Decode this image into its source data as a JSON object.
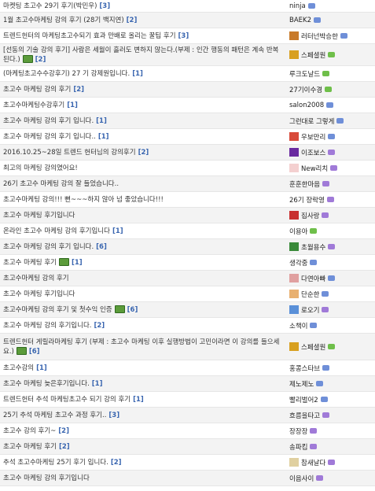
{
  "rows": [
    {
      "title": "마켓팅 초고수 29기 후기(박민우)",
      "count": "[3]",
      "author": "ninja",
      "avatar": "",
      "level": "#6f8fd8"
    },
    {
      "title": "1월 초고수마케팅 강의 후기 (28기 백지연)",
      "count": "[2]",
      "author": "BAEK2",
      "avatar": "",
      "level": "#6f8fd8"
    },
    {
      "title": "트렌드헌터의 마케팅초고수되기 효과 만배로 올리는 꿀팁 후기",
      "count": "[3]",
      "author": "러터넌박승한",
      "avatar": "#c87a2a",
      "level": "#6f8fd8"
    },
    {
      "title": "[선동의 기술 강의 후기] 사람은 세월이 흘러도 변하지 않는다.(부제 : 인간 행동의 패턴은 계속 반복된다.)",
      "count": "[2]",
      "author": "스페셜원",
      "avatar": "#d8a020",
      "level": "#6fbf4a",
      "img": true
    },
    {
      "title": "(마케팅초고수수강후기) 27 기 강제원입니다.",
      "count": "[1]",
      "author": "루크도날드",
      "avatar": "",
      "level": "#6fbf4a"
    },
    {
      "title": "초고수 마케팅 강의 후기",
      "count": "[2]",
      "author": "27기이수경",
      "avatar": "",
      "level": "#6fbf4a"
    },
    {
      "title": "초고수마케팅수강후기",
      "count": "[1]",
      "author": "salon2008",
      "avatar": "",
      "level": "#6f8fd8"
    },
    {
      "title": "초고수 마케팅 강의 후기 입니다.",
      "count": "[1]",
      "author": "그런대로 그렇게",
      "avatar": "",
      "level": "#6f8fd8"
    },
    {
      "title": "초고수 마케팅 강의 후기 입니다..",
      "count": "[1]",
      "author": "우보만리",
      "avatar": "#d84a3a",
      "level": "#6f8fd8"
    },
    {
      "title": "2016.10.25~28일 트렌드 헌터님의 강의후기",
      "count": "[2]",
      "author": "이조보스",
      "avatar": "#6a2aa0",
      "level": "#a07ad8"
    },
    {
      "title": "최고의 마케팅 강의였어요!",
      "count": "",
      "author": "New리치",
      "avatar": "#f4d0d0",
      "level": "#a07ad8"
    },
    {
      "title": "26기 초고수 마케팅 강의 잘 들었습니다..",
      "count": "",
      "author": "훈훈한마음",
      "avatar": "",
      "level": "#a07ad8"
    },
    {
      "title": "초고수마케팅 강의!!! 뻔~~~하지 않아 넘 좋았습니다!!!",
      "count": "",
      "author": "26기 장락영",
      "avatar": "",
      "level": "#a07ad8"
    },
    {
      "title": "초고수 마케팅 후기입니다",
      "count": "",
      "author": "집사랑",
      "avatar": "#c83030",
      "level": "#a07ad8"
    },
    {
      "title": "온라인 초고수 마케팅 강의 후기입니다",
      "count": "[1]",
      "author": "이용아",
      "avatar": "",
      "level": "#6fbf4a"
    },
    {
      "title": "초고수 마케팅 강의 후기 입니다.",
      "count": "[6]",
      "author": "초월용수",
      "avatar": "#3a8a3a",
      "level": "#a07ad8"
    },
    {
      "title": "초고수 마케팅 후기",
      "count": "[1]",
      "author": "생각중",
      "avatar": "",
      "level": "#6f8fd8",
      "img": true
    },
    {
      "title": "초고수마케팅 강의 후기",
      "count": "",
      "author": "다연아빠",
      "avatar": "#e0a0a0",
      "level": "#6f8fd8"
    },
    {
      "title": "초고수 마케팅 후기입니다",
      "count": "",
      "author": "단순한",
      "avatar": "#e8b070",
      "level": "#6f8fd8"
    },
    {
      "title": "초고수마케팅 강의 후기 및 첫수익 인증",
      "count": "[6]",
      "author": "로오기",
      "avatar": "#5a90d8",
      "level": "#a07ad8",
      "img": true
    },
    {
      "title": "초고수 마케팅 강의 후기입니다.",
      "count": "[2]",
      "author": "소책이",
      "avatar": "",
      "level": "#6f8fd8"
    },
    {
      "title": "트렌드헌터 게릴라마케팅 후기 (부제 : 초고수 마케팅 이후 실행방법이 고민이라면 이 강의를 들으세요.)",
      "count": "[6]",
      "author": "스페셜원",
      "avatar": "#d8a020",
      "level": "#6fbf4a",
      "img": true
    },
    {
      "title": "초고수강의",
      "count": "[1]",
      "author": "홍콩스타브",
      "avatar": "",
      "level": "#6f8fd8"
    },
    {
      "title": "초고수 마케팅 늦은후기입니다.",
      "count": "[1]",
      "author": "제노제노",
      "avatar": "",
      "level": "#6f8fd8"
    },
    {
      "title": "트렌드헌터 추석 마케팅초고수 되기 강의 후기",
      "count": "[1]",
      "author": "빨리벌어2",
      "avatar": "",
      "level": "#6f8fd8"
    },
    {
      "title": "25기 추석 마케팅 초고수 과정 후기..",
      "count": "[3]",
      "author": "흐름을타고",
      "avatar": "",
      "level": "#a07ad8"
    },
    {
      "title": "초고수 강의 후기~",
      "count": "[2]",
      "author": "장장장",
      "avatar": "",
      "level": "#a07ad8"
    },
    {
      "title": "초고수 마케팅 후기",
      "count": "[2]",
      "author": "송파킴",
      "avatar": "",
      "level": "#a07ad8"
    },
    {
      "title": "추석 초고수마케팅 25기 후기 입니다.",
      "count": "[2]",
      "author": "참새날다",
      "avatar": "#e0d0a0",
      "level": "#a07ad8"
    },
    {
      "title": "초고수 마케팅 강의 후기입니다",
      "count": "",
      "author": "이음사이",
      "avatar": "",
      "level": "#a07ad8"
    }
  ]
}
